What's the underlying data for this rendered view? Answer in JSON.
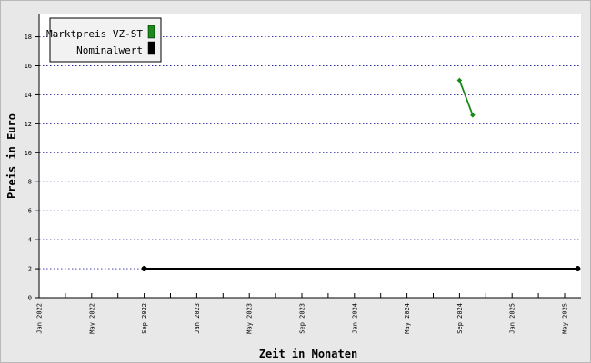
{
  "chart_data": {
    "type": "line",
    "xlabel": "Zeit in Monaten",
    "ylabel": "Preis in Euro",
    "ylim": [
      0,
      19.6
    ],
    "y_ticks": [
      0,
      2,
      4,
      6,
      8,
      10,
      12,
      14,
      16,
      18
    ],
    "x_ticks": [
      "Jan 2022",
      "May 2022",
      "Sep 2022",
      "Jan 2023",
      "May 2023",
      "Sep 2023",
      "Jan 2024",
      "May 2024",
      "Sep 2024",
      "Jan 2025",
      "May 2025"
    ],
    "grid": "horizontal-dotted",
    "legend_position": "top-left",
    "series": [
      {
        "name": "Marktpreis VZ-ST",
        "color": "#1a8a1a",
        "points": [
          {
            "x": "2024-09-01",
            "y": 15.0
          },
          {
            "x": "2024-10-01",
            "y": 12.6
          }
        ]
      },
      {
        "name": "Nominalwert",
        "color": "#000000",
        "points": [
          {
            "x": "2022-09-01",
            "y": 2.0
          },
          {
            "x": "2025-06-01",
            "y": 2.0
          }
        ]
      }
    ]
  }
}
